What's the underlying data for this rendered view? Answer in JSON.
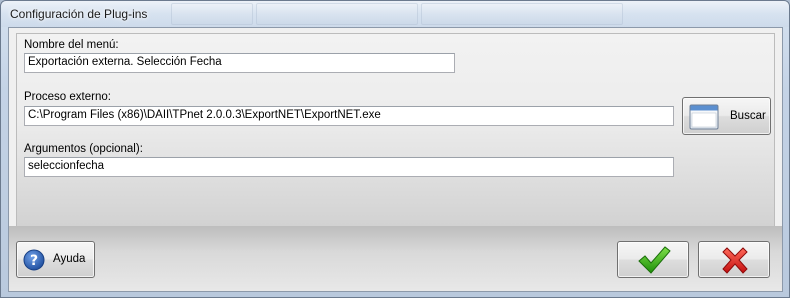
{
  "window": {
    "title": "Configuración de Plug-ins"
  },
  "form": {
    "menu_name_label": "Nombre del menú:",
    "menu_name_value": "Exportación externa. Selección Fecha",
    "process_label": "Proceso externo:",
    "process_value": "C:\\Program Files (x86)\\DAII\\TPnet 2.0.0.3\\ExportNET\\ExportNET.exe",
    "args_label": "Argumentos (opcional):",
    "args_value": "seleccionfecha",
    "browse_label": "Buscar",
    "browse_icon": "window-icon"
  },
  "footer": {
    "help_label": "Ayuda",
    "help_icon": "help-icon",
    "ok_icon": "checkmark-icon",
    "cancel_icon": "cross-icon"
  },
  "colors": {
    "help_blue": "#2a5fb4",
    "ok_green": "#2fae12",
    "cancel_red": "#d81a1a"
  }
}
